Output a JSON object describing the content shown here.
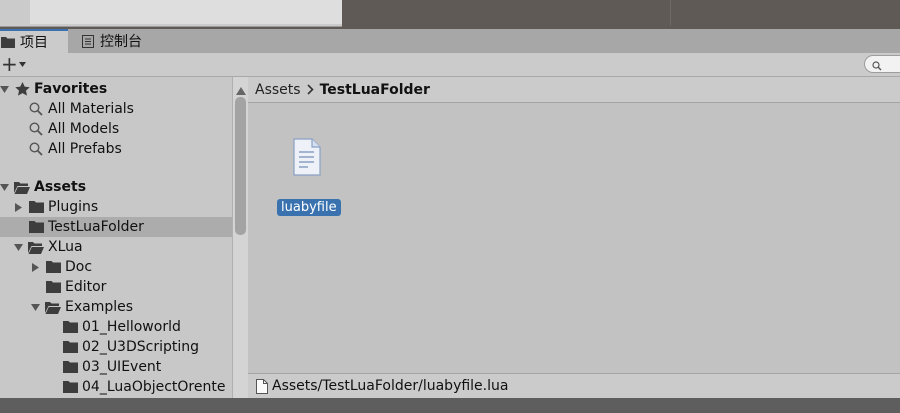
{
  "tabs": [
    {
      "label": "项目",
      "icon": "folder-icon",
      "active": true
    },
    {
      "label": "控制台",
      "icon": "console-icon",
      "active": false
    }
  ],
  "toolbar": {
    "add_label": "+"
  },
  "tree": {
    "favorites": {
      "label": "Favorites",
      "items": [
        "All Materials",
        "All Models",
        "All Prefabs"
      ]
    },
    "assets": {
      "label": "Assets",
      "plugins": "Plugins",
      "test_lua_folder": "TestLuaFolder",
      "xlua": "XLua",
      "doc": "Doc",
      "editor": "Editor",
      "examples": "Examples",
      "example_items": [
        "01_Helloworld",
        "02_U3DScripting",
        "03_UIEvent",
        "04_LuaObjectOrente"
      ]
    }
  },
  "breadcrumb": {
    "root": "Assets",
    "current": "TestLuaFolder"
  },
  "content": {
    "files": [
      {
        "name": "luabyfile",
        "icon": "file-icon"
      }
    ]
  },
  "status": {
    "path": "Assets/TestLuaFolder/luabyfile.lua"
  },
  "colors": {
    "selection": "#3a72b0",
    "panel": "#c2c2c2",
    "tree_selected": "#acacac"
  }
}
